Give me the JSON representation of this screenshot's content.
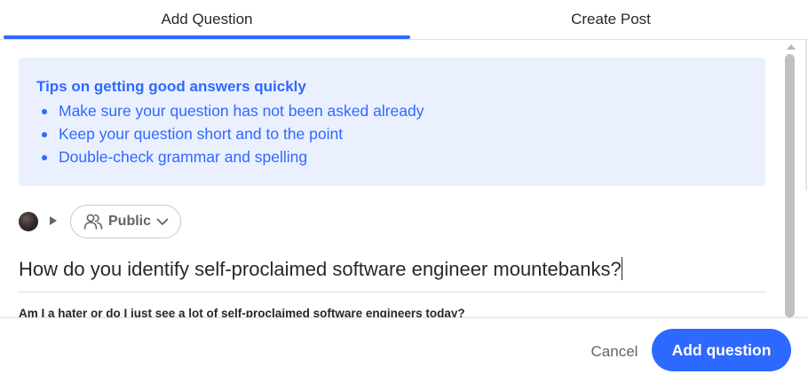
{
  "tabs": [
    {
      "label": "Add Question",
      "active": true
    },
    {
      "label": "Create Post",
      "active": false
    }
  ],
  "tips": {
    "title": "Tips on getting good answers quickly",
    "items": [
      "Make sure your question has not been asked already",
      "Keep your question short and to the point",
      "Double-check grammar and spelling"
    ]
  },
  "author": {
    "audience_label": "Public"
  },
  "question": {
    "value": "How do you identify self-proclaimed software engineer mountebanks?"
  },
  "suggestion": {
    "text": "Am I a hater or do I just see a lot of self-proclaimed software engineers today?"
  },
  "footer": {
    "cancel_label": "Cancel",
    "submit_label": "Add question"
  },
  "colors": {
    "accent": "#2e69ff",
    "tips_background": "#ebf0ff",
    "muted_text": "#636466"
  },
  "icons": {
    "audience": "people-icon",
    "audience_dropdown": "chevron-down-icon",
    "author_expand": "caret-right-icon"
  }
}
